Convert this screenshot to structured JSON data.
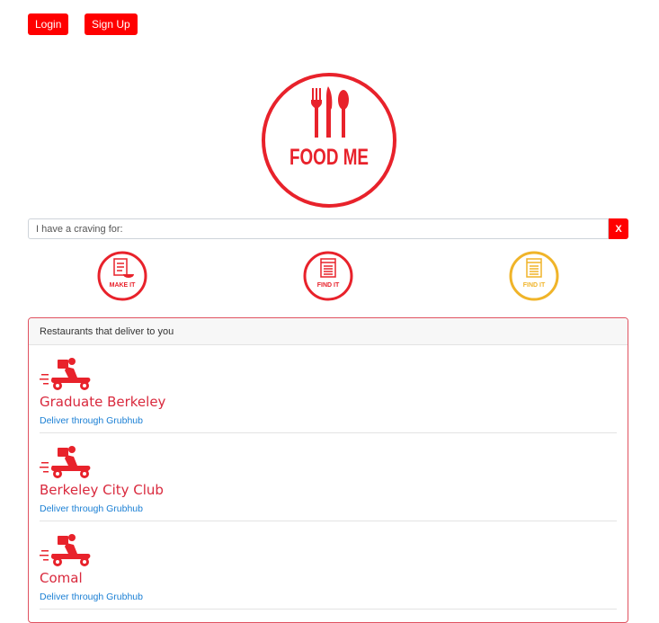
{
  "header": {
    "login_label": "Login",
    "signup_label": "Sign Up"
  },
  "logo": {
    "text": "FOOD ME",
    "color": "#e8222b"
  },
  "search": {
    "placeholder": "I have a craving for:",
    "clear_label": "X"
  },
  "modes": [
    {
      "label": "MAKE IT",
      "icon": "recipe-icon",
      "color": "#e8222b"
    },
    {
      "label": "FIND IT",
      "icon": "menu-icon",
      "color": "#e8222b"
    },
    {
      "label": "FIND IT",
      "icon": "menu-icon",
      "color": "#f0b429"
    }
  ],
  "restaurants_panel": {
    "title": "Restaurants that deliver to you",
    "items": [
      {
        "name": "Graduate Berkeley",
        "link": "Deliver through Grubhub",
        "icon": "delivery-scooter-icon"
      },
      {
        "name": "Berkeley City Club",
        "link": "Deliver through Grubhub",
        "icon": "delivery-scooter-icon"
      },
      {
        "name": "Comal",
        "link": "Deliver through Grubhub",
        "icon": "delivery-scooter-icon"
      }
    ]
  },
  "colors": {
    "brand_red": "#ff0000",
    "accent_red": "#e8222b",
    "yellow": "#f0b429",
    "link_blue": "#1a7fd4"
  }
}
